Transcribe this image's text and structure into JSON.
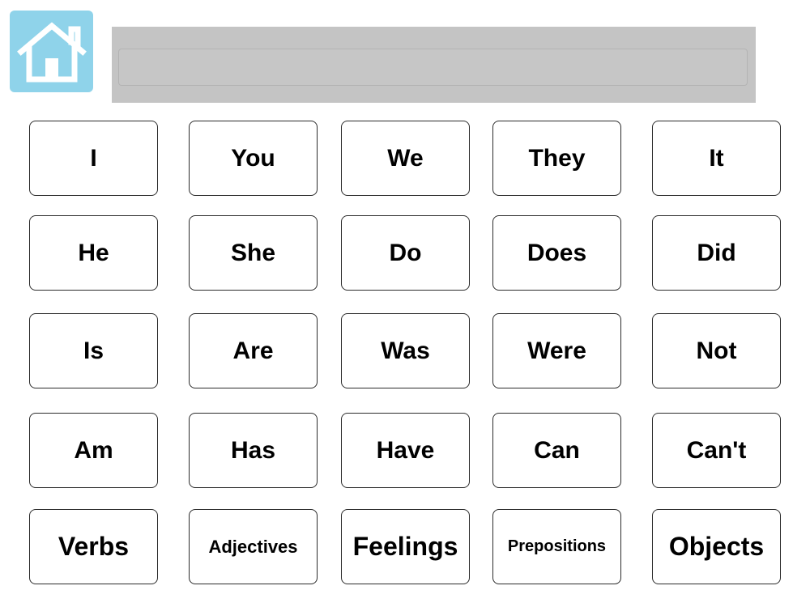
{
  "home": {
    "icon": "home-icon",
    "background_color": "#8fd3ea"
  },
  "sentence": {
    "value": "",
    "placeholder": ""
  },
  "rows": [
    [
      "I",
      "You",
      "We",
      "They",
      "It"
    ],
    [
      "He",
      "She",
      "Do",
      "Does",
      "Did"
    ],
    [
      "Is",
      "Are",
      "Was",
      "Were",
      "Not"
    ],
    [
      "Am",
      "Has",
      "Have",
      "Can",
      "Can't"
    ],
    [
      "Verbs",
      "Adjectives",
      "Feelings",
      "Prepositions",
      "Objects"
    ]
  ]
}
